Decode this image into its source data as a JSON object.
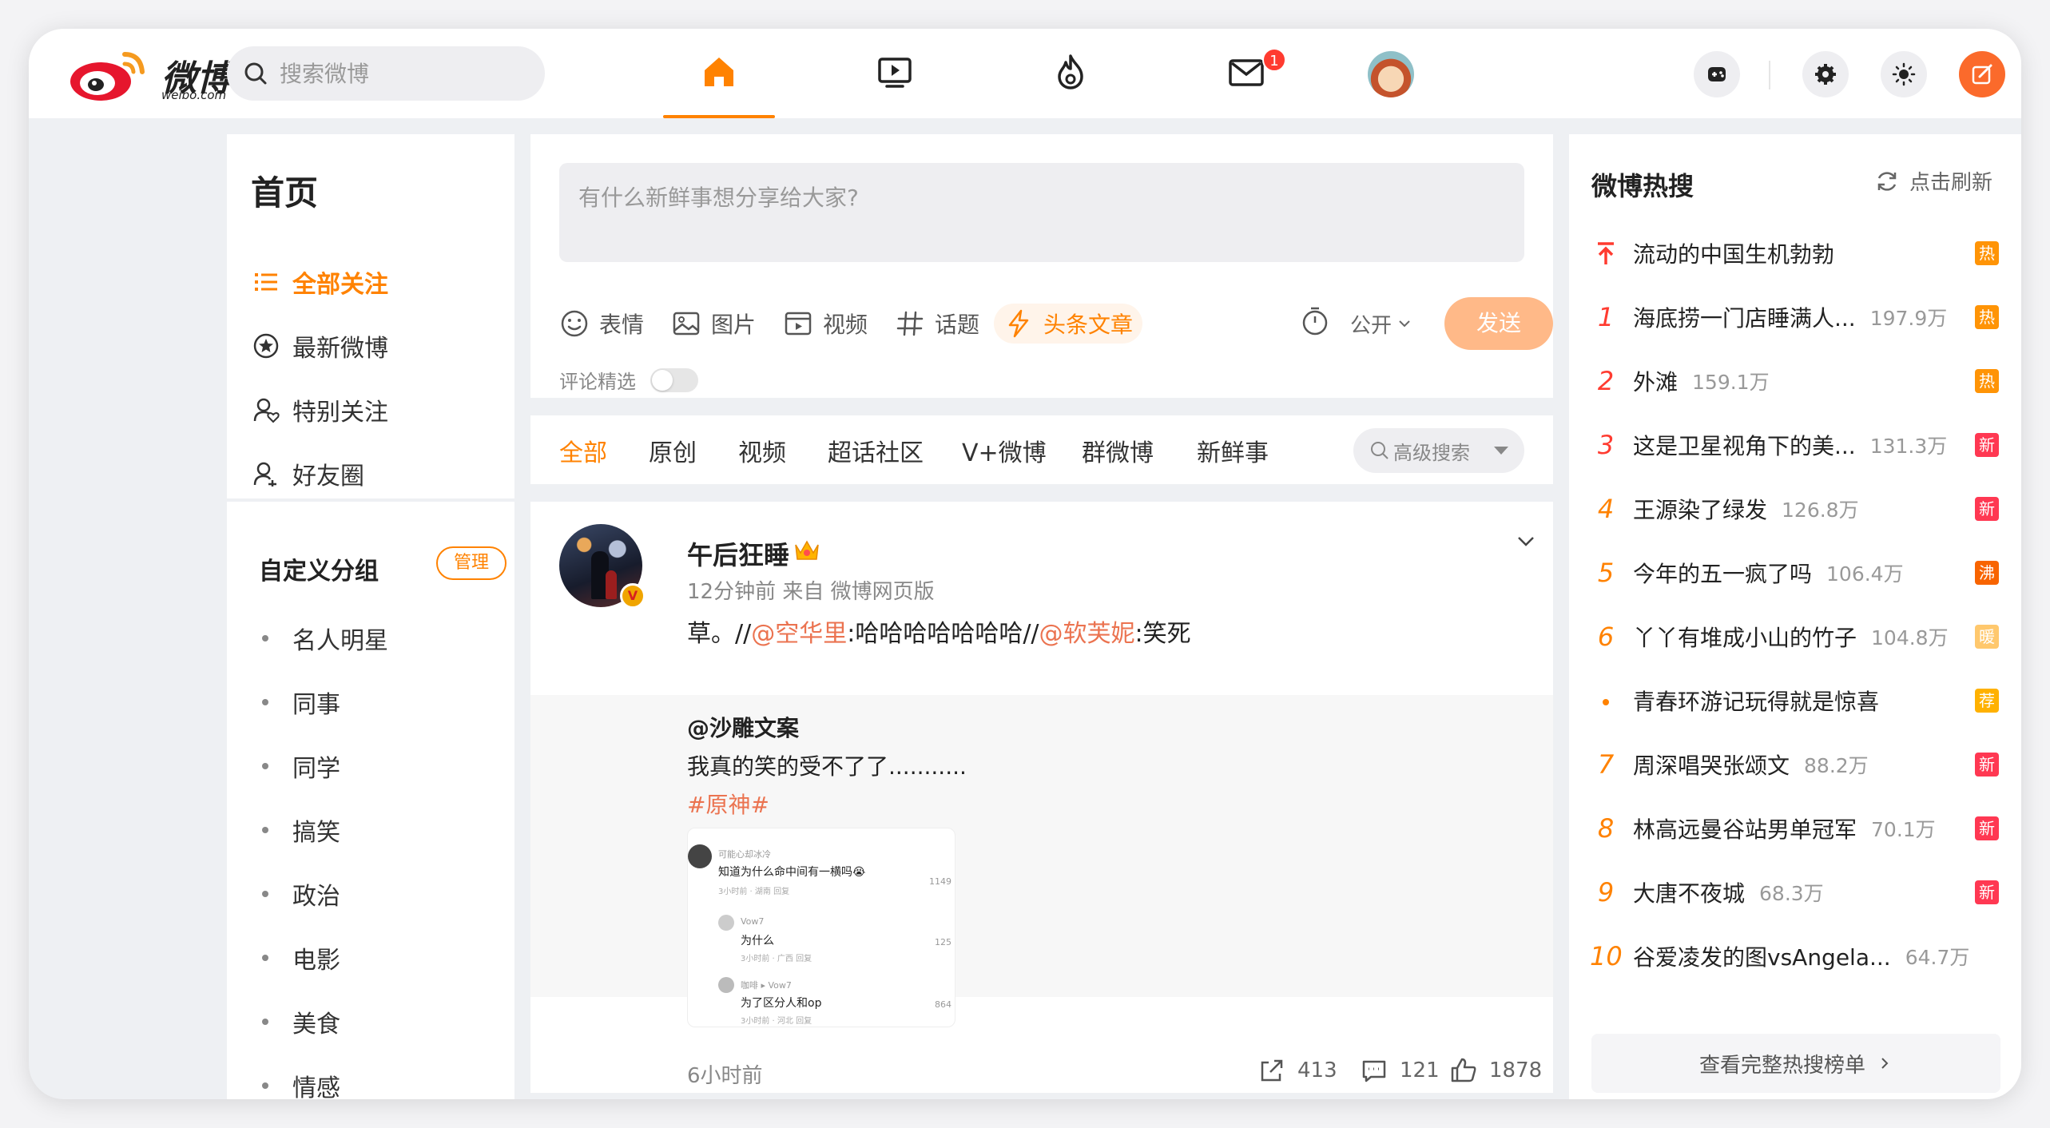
{
  "header": {
    "logo_text": "微博",
    "logo_sub": "weibo.com",
    "search_placeholder": "搜索微博",
    "nav": [
      {
        "name": "home",
        "icon": "home-icon",
        "active": true
      },
      {
        "name": "video",
        "icon": "video-icon"
      },
      {
        "name": "hot",
        "icon": "flame-icon"
      },
      {
        "name": "messages",
        "icon": "mail-icon",
        "badge": "1"
      },
      {
        "name": "profile",
        "icon": "avatar"
      }
    ],
    "right_buttons": [
      "game-icon",
      "settings-icon",
      "brightness-icon",
      "compose-icon"
    ]
  },
  "sidebar": {
    "title": "首页",
    "nav": [
      {
        "label": "全部关注",
        "icon": "list-icon",
        "active": true
      },
      {
        "label": "最新微博",
        "icon": "star-circle-icon"
      },
      {
        "label": "特别关注",
        "icon": "user-heart-icon"
      },
      {
        "label": "好友圈",
        "icon": "friends-icon"
      }
    ],
    "group_title": "自定义分组",
    "manage_label": "管理",
    "groups": [
      "名人明星",
      "同事",
      "同学",
      "搞笑",
      "政治",
      "电影",
      "美食",
      "情感"
    ]
  },
  "composer": {
    "placeholder": "有什么新鲜事想分享给大家?",
    "tools": [
      "表情",
      "图片",
      "视频",
      "话题",
      "头条文章"
    ],
    "visibility": "公开",
    "send_label": "发送",
    "comment_select_label": "评论精选"
  },
  "filters": {
    "tabs": [
      "全部",
      "原创",
      "视频",
      "超话社区",
      "V+微博",
      "群微博",
      "新鲜事"
    ],
    "active": "全部",
    "advanced_search": "高级搜索"
  },
  "post": {
    "author": "午后狂睡",
    "meta": "12分钟前  来自 微博网页版",
    "text_prefix": "草。//",
    "mention1": "@空华里",
    "text_mid": ":哈哈哈哈哈哈哈//",
    "mention2": "@软芙妮",
    "text_suffix": ":笑死",
    "repost": {
      "user": "@沙雕文案",
      "text": "我真的笑的受不了了...........",
      "tag": "#原神#",
      "image_comments": [
        {
          "user": "可能心却冰冷",
          "text": "知道为什么命中间有一横吗😭",
          "meta": "3小时前 · 湖南  回复",
          "likes": "1149"
        },
        {
          "user": "Vow7",
          "text": "为什么",
          "meta": "3小时前 · 广西  回复",
          "likes": "125"
        },
        {
          "user": "咖啡 ▸ Vow7",
          "text": "为了区分人和op",
          "meta": "3小时前 · 河北  回复",
          "likes": "864"
        }
      ]
    },
    "time": "6小时前",
    "shares": "413",
    "comments": "121",
    "likes": "1878"
  },
  "hot_search": {
    "title": "微博热搜",
    "refresh_label": "点击刷新",
    "items": [
      {
        "rank": "",
        "word": "流动的中国生机勃勃",
        "count": "",
        "tag": "热",
        "tag_type": "hot",
        "pinned": true
      },
      {
        "rank": "1",
        "word": "海底捞一门店睡满人...",
        "count": "197.9万",
        "tag": "热",
        "tag_type": "hot"
      },
      {
        "rank": "2",
        "word": "外滩",
        "count": "159.1万",
        "tag": "热",
        "tag_type": "hot"
      },
      {
        "rank": "3",
        "word": "这是卫星视角下的美...",
        "count": "131.3万",
        "tag": "新",
        "tag_type": "new"
      },
      {
        "rank": "4",
        "word": "王源染了绿发",
        "count": "126.8万",
        "tag": "新",
        "tag_type": "new"
      },
      {
        "rank": "5",
        "word": "今年的五一疯了吗",
        "count": "106.4万",
        "tag": "沸",
        "tag_type": "boil"
      },
      {
        "rank": "6",
        "word": "丫丫有堆成小山的竹子",
        "count": "104.8万",
        "tag": "暖",
        "tag_type": "warm"
      },
      {
        "rank": "•",
        "word": "青春环游记玩得就是惊喜",
        "count": "",
        "tag": "荐",
        "tag_type": "rec"
      },
      {
        "rank": "7",
        "word": "周深唱哭张颂文",
        "count": "88.2万",
        "tag": "新",
        "tag_type": "new"
      },
      {
        "rank": "8",
        "word": "林高远曼谷站男单冠军",
        "count": "70.1万",
        "tag": "新",
        "tag_type": "new"
      },
      {
        "rank": "9",
        "word": "大唐不夜城",
        "count": "68.3万",
        "tag": "新",
        "tag_type": "new"
      },
      {
        "rank": "10",
        "word": "谷爱凌发的图vsAngela...",
        "count": "64.7万",
        "tag": "",
        "tag_type": ""
      }
    ],
    "full_list_label": "查看完整热搜榜单"
  },
  "colors": {
    "accent": "#ff8200",
    "mention": "#eb7350",
    "hot": "#ff9406",
    "new": "#ff3852"
  }
}
